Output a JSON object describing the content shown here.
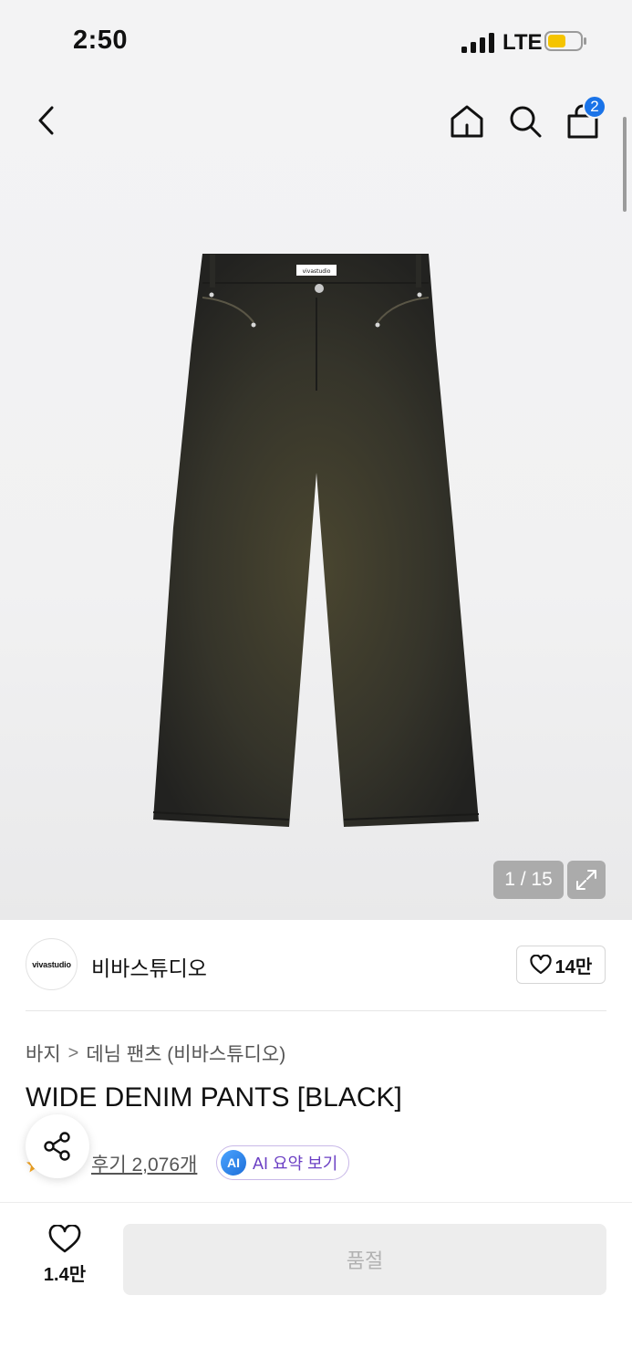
{
  "status_bar": {
    "time": "2:50",
    "network": "LTE",
    "icons": [
      "signal-icon",
      "battery-icon"
    ]
  },
  "header": {
    "cart_count": "2",
    "icons": [
      "back-icon",
      "home-icon",
      "search-icon",
      "cart-icon"
    ]
  },
  "gallery": {
    "pager": "1 / 15",
    "current_image": 1,
    "total_images": 15,
    "image_label": "vivastudio"
  },
  "brand": {
    "logo_text": "vivastudio",
    "name": "비바스튜디오",
    "likes": "14만"
  },
  "breadcrumb": {
    "level1": "바지",
    "separator": ">",
    "level2": "데님 팬츠 (비바스튜디오)"
  },
  "product": {
    "title": "WIDE DENIM PANTS [BLACK]"
  },
  "rating": {
    "reviews": "후기 2,076개",
    "ai_icon": "AI",
    "ai_label": "AI 요약 보기"
  },
  "bottom_bar": {
    "wish_count": "1.4만",
    "soldout_label": "품절"
  },
  "colors": {
    "accent_blue": "#1a73e8",
    "ai_purple": "#6b3fc4",
    "battery_yellow": "#f5c400",
    "star_orange": "#f5a623"
  }
}
